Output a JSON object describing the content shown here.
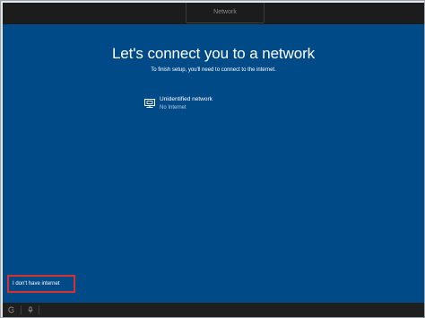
{
  "header": {
    "tab_label": "Network"
  },
  "main": {
    "title": "Let's connect you to a network",
    "subtitle": "To finish setup, you'll need to connect to the internet."
  },
  "networks": [
    {
      "name": "Unidentified network",
      "status": "No Internet",
      "icon": "ethernet-icon"
    }
  ],
  "footer": {
    "no_internet_label": "I don't have internet"
  },
  "bottom_bar": {
    "icons": [
      "ease-of-access-icon",
      "microphone-icon"
    ]
  },
  "colors": {
    "background": "#004b87",
    "bars": "#1c1c1c",
    "highlight": "#d9322c"
  }
}
